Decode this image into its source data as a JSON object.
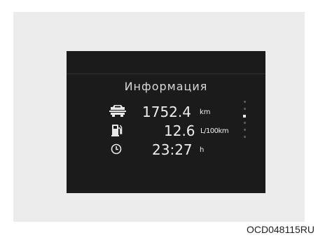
{
  "screen": {
    "title": "Информация",
    "rows": [
      {
        "icon": "car-range-icon",
        "value": "1752.4",
        "unit": "km"
      },
      {
        "icon": "fuel-pump-icon",
        "value": "12.6",
        "unit": "L/100km"
      },
      {
        "icon": "clock-icon",
        "value": "23:27",
        "unit": "h"
      }
    ],
    "page_indicator": {
      "total": 6,
      "active_index": 2
    }
  },
  "figure_code": "OCD048115RU",
  "colors": {
    "panel_bg": "#ececec",
    "screen_bg": "#1b1b1b",
    "text": "#eeeeee"
  }
}
